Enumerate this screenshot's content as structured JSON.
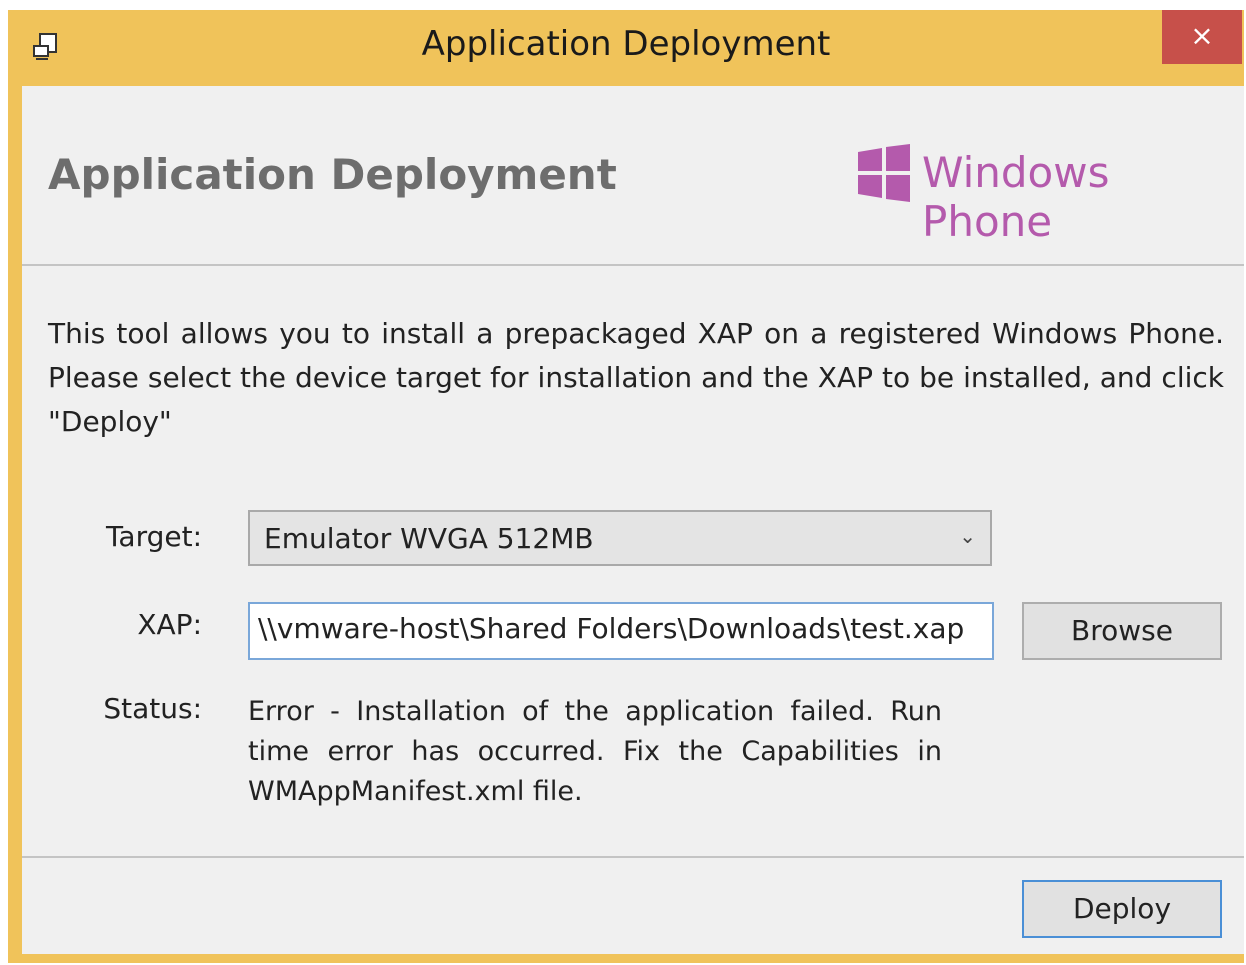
{
  "window": {
    "title": "Application Deployment",
    "close_label": "×"
  },
  "header": {
    "title": "Application Deployment",
    "logo_text": "Windows Phone"
  },
  "description": "This tool allows you to install a prepackaged XAP on a registered Windows Phone. Please select the device target for installation and the XAP to be installed, and click \"Deploy\"",
  "form": {
    "target_label": "Target:",
    "target_value": "Emulator WVGA 512MB",
    "xap_label": "XAP:",
    "xap_value": "\\\\vmware-host\\Shared Folders\\Downloads\\test.xap",
    "browse_label": "Browse",
    "status_label": "Status:",
    "status_value": "Error - Installation of the application failed. Run time error has occurred. Fix the Capabilities in WMAppManifest.xml file."
  },
  "footer": {
    "deploy_label": "Deploy"
  },
  "colors": {
    "titlebar": "#f0c35a",
    "close": "#c7504a",
    "brand": "#b45aac"
  }
}
